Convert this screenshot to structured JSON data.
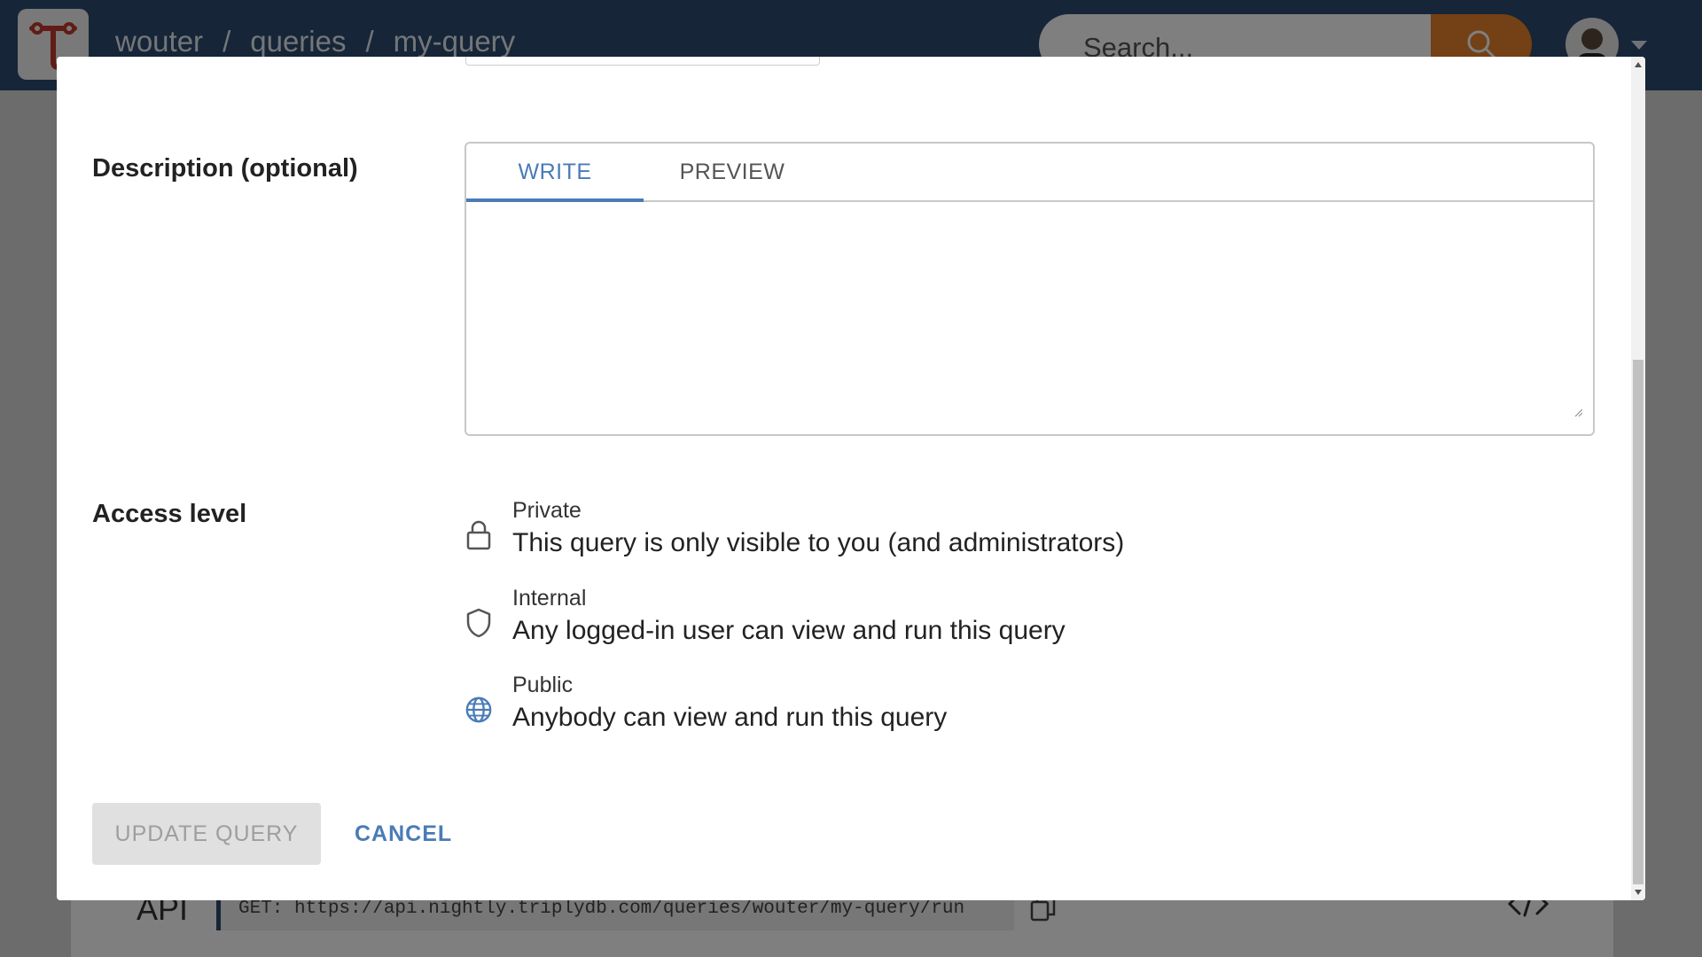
{
  "header": {
    "breadcrumb": [
      "wouter",
      "queries",
      "my-query"
    ],
    "separator": "/",
    "search_placeholder": "Search...",
    "accent_color": "#e8812c",
    "bar_color": "#2c4a6e"
  },
  "background": {
    "api_label": "API",
    "api_url": "GET: https://api.nightly.triplydb.com/queries/wouter/my-query/run"
  },
  "dialog": {
    "description": {
      "label": "Description (optional)",
      "tabs": [
        {
          "label": "WRITE",
          "active": true
        },
        {
          "label": "PREVIEW",
          "active": false
        }
      ],
      "value": ""
    },
    "access": {
      "label": "Access level",
      "options": [
        {
          "title": "Private",
          "description": "This query is only visible to you (and administrators)",
          "icon": "lock-icon"
        },
        {
          "title": "Internal",
          "description": "Any logged-in user can view and run this query",
          "icon": "shield-icon"
        },
        {
          "title": "Public",
          "description": "Anybody can view and run this query",
          "icon": "globe-icon",
          "selected": true
        }
      ]
    },
    "actions": {
      "update_label": "UPDATE QUERY",
      "update_disabled": true,
      "cancel_label": "CANCEL"
    },
    "link_color": "#4a7bb7"
  }
}
